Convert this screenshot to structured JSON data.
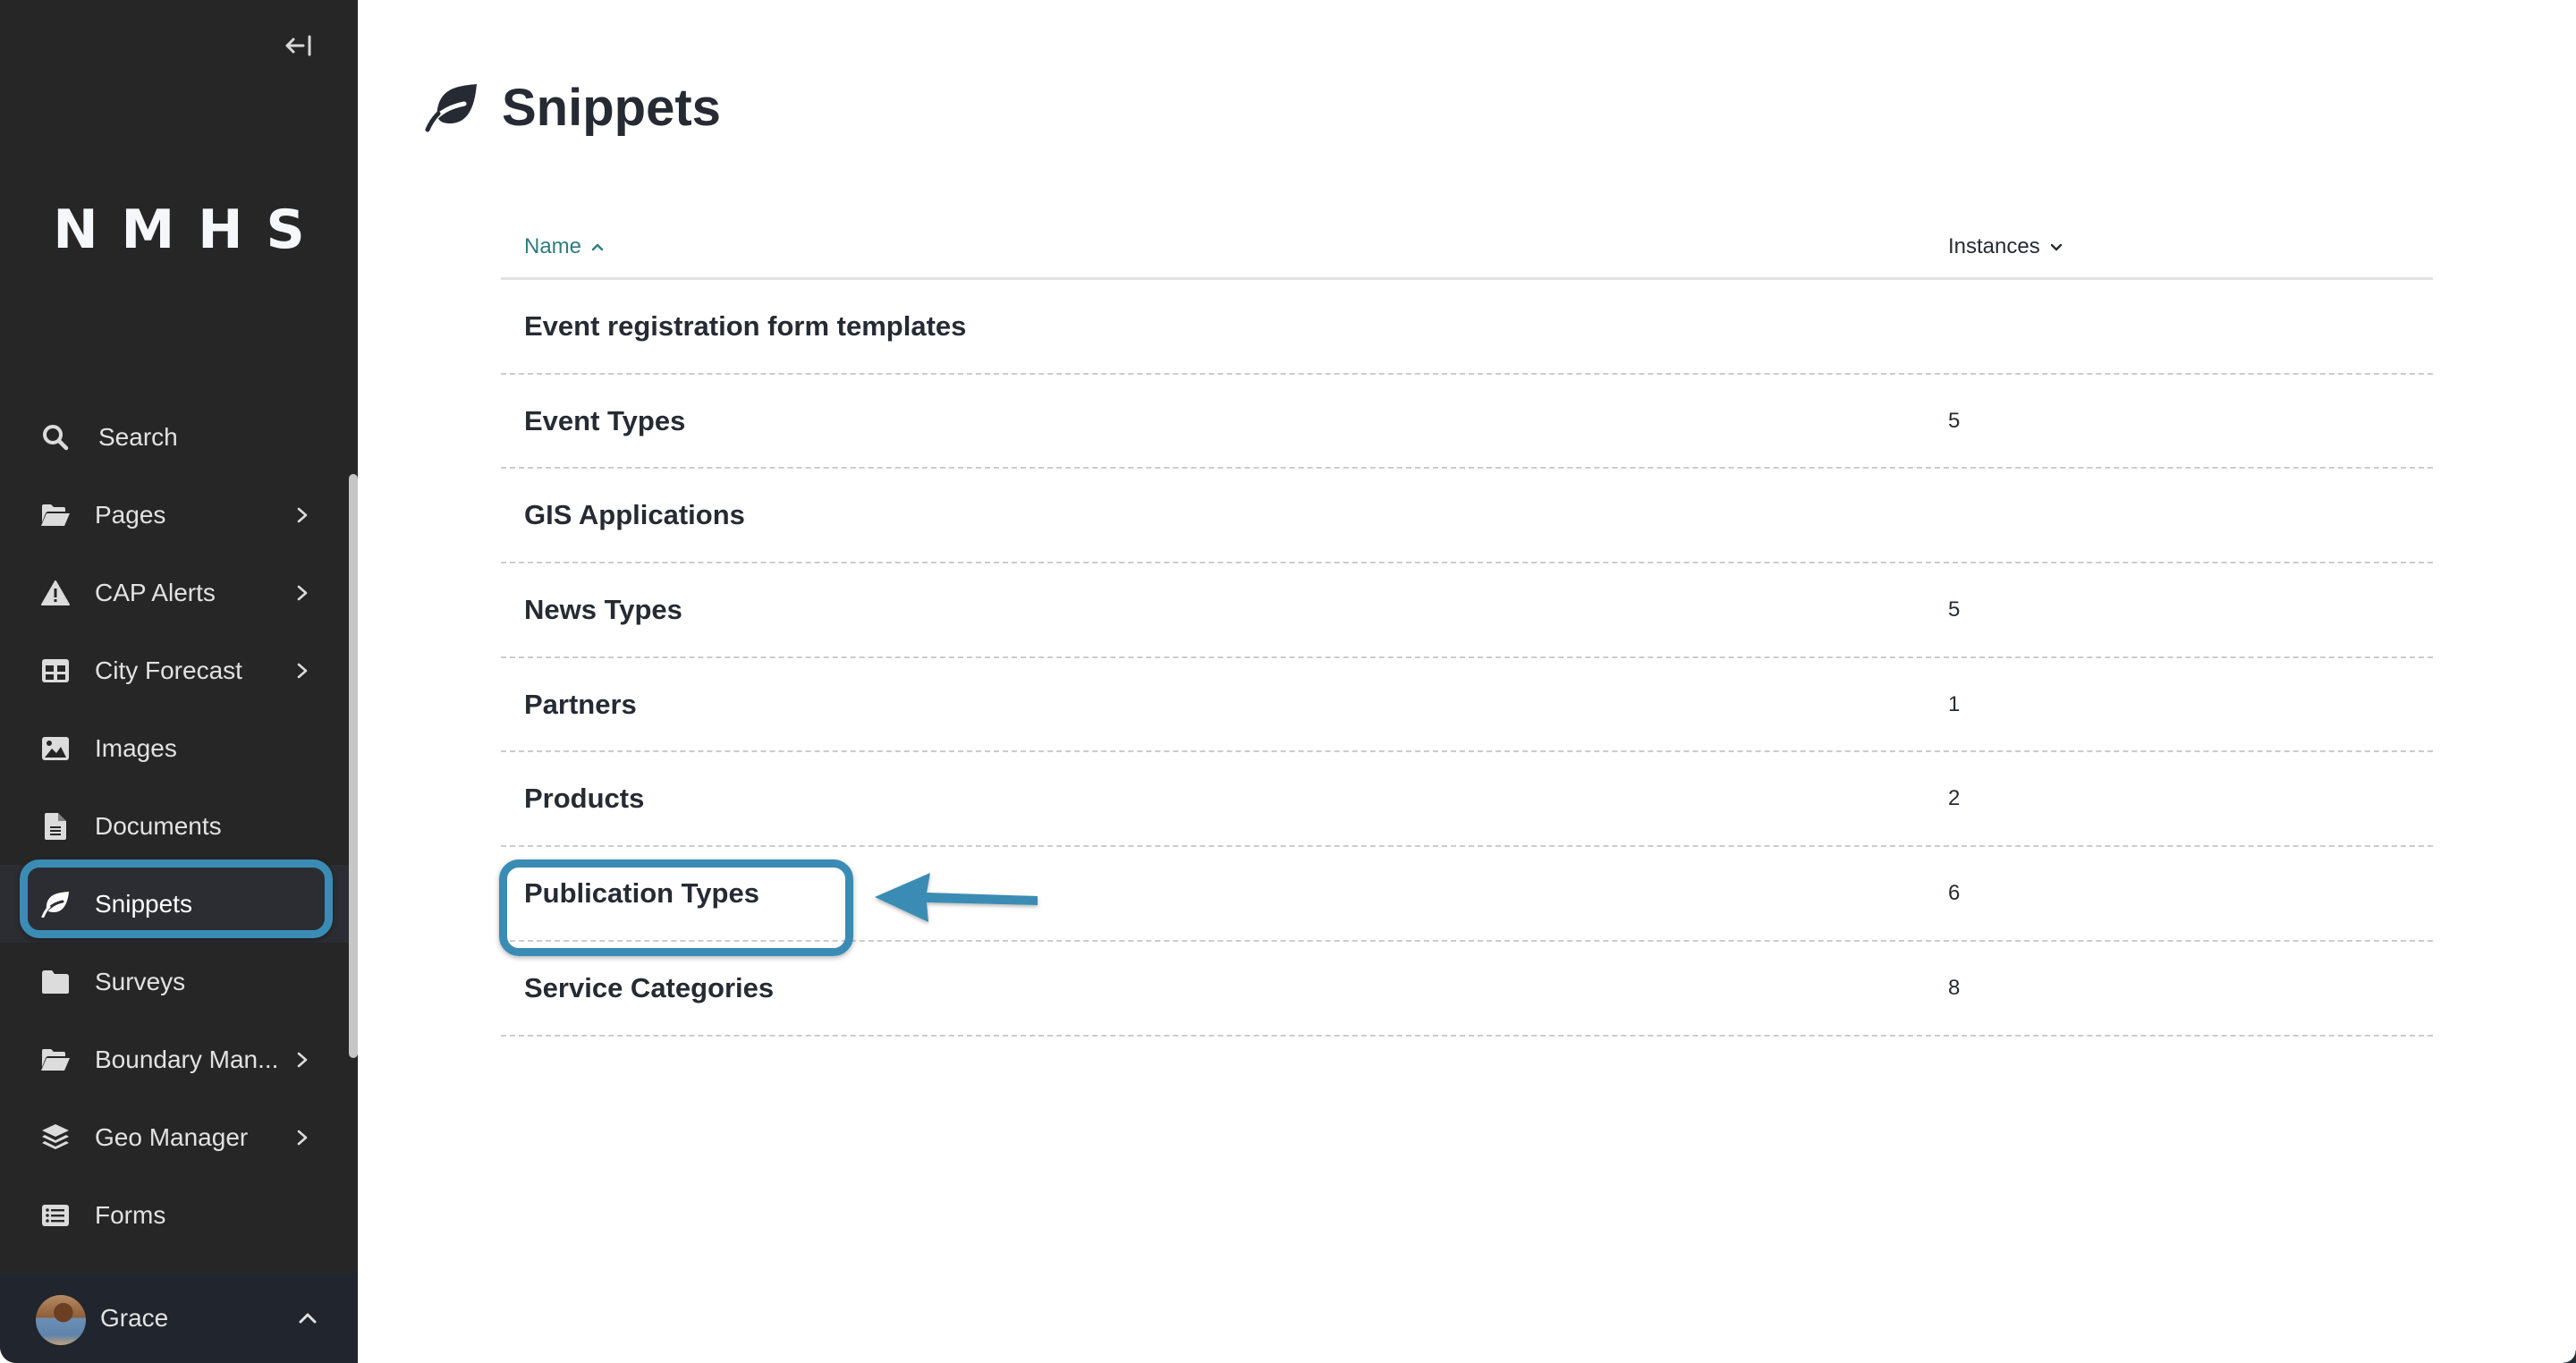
{
  "sidebar": {
    "collapse_icon": "collapse-left-icon",
    "logo": "NMHS",
    "items": [
      {
        "label": "Search",
        "icon": "search-icon",
        "has_submenu": false,
        "active": false
      },
      {
        "label": "Pages",
        "icon": "folder-open-icon",
        "has_submenu": true,
        "active": false
      },
      {
        "label": "CAP Alerts",
        "icon": "warning-icon",
        "has_submenu": true,
        "active": false
      },
      {
        "label": "City Forecast",
        "icon": "table-icon",
        "has_submenu": true,
        "active": false
      },
      {
        "label": "Images",
        "icon": "image-icon",
        "has_submenu": false,
        "active": false
      },
      {
        "label": "Documents",
        "icon": "document-icon",
        "has_submenu": false,
        "active": false
      },
      {
        "label": "Snippets",
        "icon": "leaf-icon",
        "has_submenu": false,
        "active": true
      },
      {
        "label": "Surveys",
        "icon": "folder-icon",
        "has_submenu": false,
        "active": false
      },
      {
        "label": "Boundary Man...",
        "icon": "folder-open-icon",
        "has_submenu": true,
        "active": false
      },
      {
        "label": "Geo Manager",
        "icon": "layers-icon",
        "has_submenu": true,
        "active": false
      },
      {
        "label": "Forms",
        "icon": "list-icon",
        "has_submenu": false,
        "active": false
      }
    ],
    "user": {
      "name": "Grace",
      "avatar": "user-avatar",
      "chevron": "chevron-up-icon"
    }
  },
  "main": {
    "title": "Snippets",
    "title_icon": "leaf-icon",
    "table": {
      "columns": [
        {
          "label": "Name",
          "sort": "ascending",
          "sort_icon": "chevron-up-icon"
        },
        {
          "label": "Instances",
          "sort": "none",
          "sort_icon": "chevron-down-icon"
        }
      ],
      "rows": [
        {
          "name": "Event registration form templates",
          "instances": ""
        },
        {
          "name": "Event Types",
          "instances": "5"
        },
        {
          "name": "GIS Applications",
          "instances": ""
        },
        {
          "name": "News Types",
          "instances": "5"
        },
        {
          "name": "Partners",
          "instances": "1"
        },
        {
          "name": "Products",
          "instances": "2"
        },
        {
          "name": "Publication Types",
          "instances": "6"
        },
        {
          "name": "Service Categories",
          "instances": "8"
        }
      ]
    }
  },
  "annotations": {
    "highlight_color": "#3a8cb4",
    "highlighted_sidebar_item": "Snippets",
    "highlighted_row": "Publication Types",
    "arrow_points_to": "Publication Types"
  },
  "colors": {
    "sidebar_bg": "#262626",
    "sidebar_active_bg": "#2c2d32",
    "footer_bg": "#21252d",
    "sort_active": "#2e7d7f",
    "text_dark": "#262b33"
  }
}
